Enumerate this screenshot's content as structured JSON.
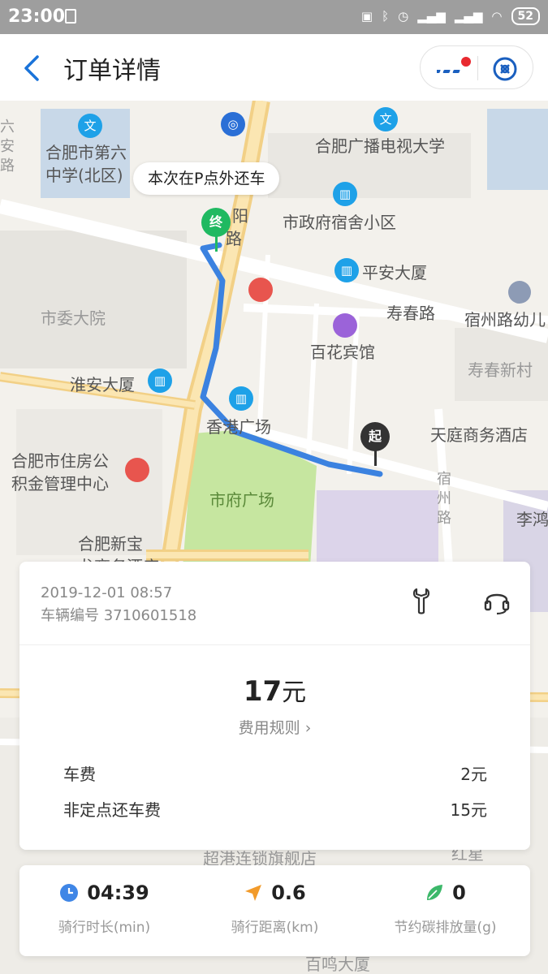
{
  "status_bar": {
    "time": "23:00",
    "battery": "52"
  },
  "header": {
    "title": "订单详情"
  },
  "map": {
    "bubble": "本次在P点外还车",
    "end_pin": "终",
    "start_pin": "起",
    "labels": {
      "school6": "合肥市第六",
      "school6b": "中学(北区)",
      "radio_univ": "合肥广播电视大学",
      "liuan": "六",
      "liuan2": "安",
      "liuan3": "路",
      "yang": "阳",
      "lu": "路",
      "gov_dorm": "市政府宿舍小区",
      "pingan": "平安大厦",
      "shouchun_rd": "寿春路",
      "suzhou_kinder": "宿州路幼儿",
      "city_committee": "市委大院",
      "baihua": "百花宾馆",
      "shouchun_village": "寿春新村",
      "huaian": "淮安大厦",
      "hk_plaza": "香港广场",
      "tianting": "天庭商务酒店",
      "housing_fund": "合肥市住房公",
      "housing_fund2": "积金管理中心",
      "city_plaza": "市府广场",
      "suzhou_rd1": "宿",
      "suzhou_rd2": "州",
      "suzhou_rd3": "路",
      "li": "李鸿",
      "xinbao": "合肥新宝",
      "xinbao2": "龙商务酒店",
      "bottom_label": "超港连锁旗舰店",
      "bottom_label2": "百鸣大厦",
      "bottom_label3": "红星"
    }
  },
  "order": {
    "datetime": "2019-12-01 08:57",
    "vehicle": "车辆编号 3710601518",
    "total_amount": "17",
    "total_unit": "元",
    "rules_link": "费用规则 ›",
    "fees": [
      {
        "name": "车费",
        "amount": "2元"
      },
      {
        "name": "非定点还车费",
        "amount": "15元"
      }
    ]
  },
  "stats": {
    "duration": {
      "value": "04:39",
      "label": "骑行时长(min)"
    },
    "distance": {
      "value": "0.6",
      "label": "骑行距离(km)"
    },
    "carbon": {
      "value": "0",
      "label": "节约碳排放量(g)"
    }
  },
  "colors": {
    "route": "#3b82e0",
    "end_pin": "#1fb961",
    "start_pin": "#333333",
    "accent": "#1a73d9"
  }
}
